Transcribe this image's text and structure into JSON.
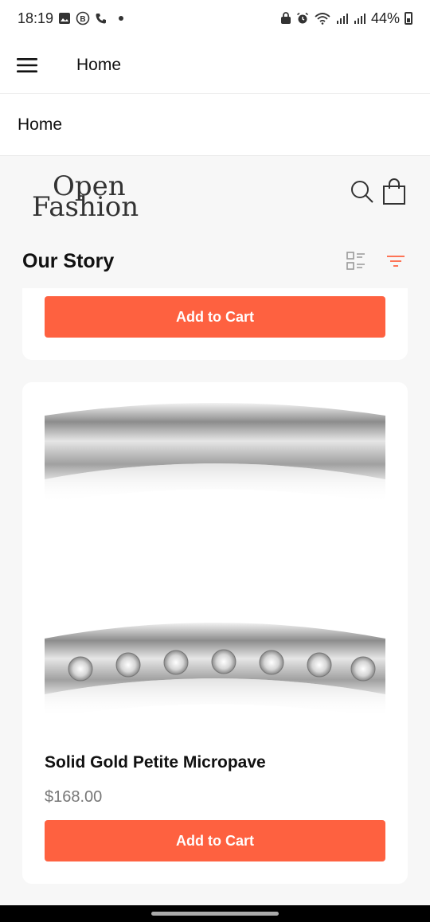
{
  "status_bar": {
    "time": "18:19",
    "battery": "44%",
    "left_icons": [
      "gallery-icon",
      "b-badge-icon",
      "phone-icon",
      "dot-icon"
    ],
    "right_icons": [
      "lock-icon",
      "alarm-icon",
      "wifi-icon",
      "signal-icon",
      "signal-icon",
      "battery-icon"
    ]
  },
  "app_bar": {
    "title": "Home",
    "menu_icon": "hamburger-icon"
  },
  "breadcrumb": {
    "label": "Home"
  },
  "brand": {
    "logo_line1": "Open",
    "logo_line2": "Fashion",
    "icons": [
      "search-icon",
      "shopping-bag-icon"
    ]
  },
  "section": {
    "title": "Our Story",
    "icons": [
      "list-view-icon",
      "filter-icon"
    ],
    "filter_color": "#fe6140"
  },
  "products": [
    {
      "cart_label": "Add to Cart"
    },
    {
      "name": "Solid Gold Petite Micropave",
      "price": "$168.00",
      "cart_label": "Add to Cart",
      "image": "silver-diamond-rings-image"
    }
  ],
  "colors": {
    "accent": "#fe6140",
    "background": "#f7f7f7",
    "card": "#ffffff"
  }
}
